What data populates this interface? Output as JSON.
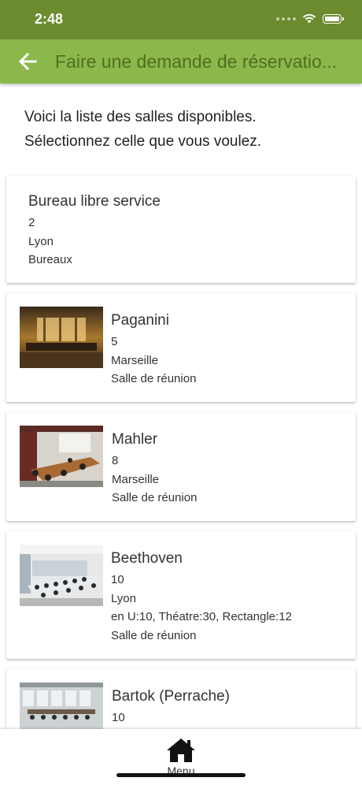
{
  "status_bar": {
    "time": "2:48"
  },
  "app_bar": {
    "title": "Faire une demande de réservatio..."
  },
  "intro": {
    "line1": "Voici la liste des salles disponibles.",
    "line2": "Sélectionnez celle que vous voulez."
  },
  "rooms": [
    {
      "name": "Bureau libre service",
      "capacity": "2",
      "city": "Lyon",
      "type": "Bureaux"
    },
    {
      "name": "Paganini",
      "capacity": "5",
      "city": "Marseille",
      "type": "Salle de réunion"
    },
    {
      "name": "Mahler",
      "capacity": "8",
      "city": "Marseille",
      "type": "Salle de réunion"
    },
    {
      "name": "Beethoven",
      "capacity": "10",
      "city": "Lyon",
      "layouts": "en U:10, Théatre:30, Rectangle:12",
      "type": "Salle de réunion"
    },
    {
      "name": "Bartok (Perrache)",
      "capacity": "10"
    }
  ],
  "bottom_nav": {
    "home_label": "Menu"
  },
  "colors": {
    "status_bar": "#6b8b2e",
    "app_bar": "#8ab84a",
    "title_text": "#516d22"
  }
}
